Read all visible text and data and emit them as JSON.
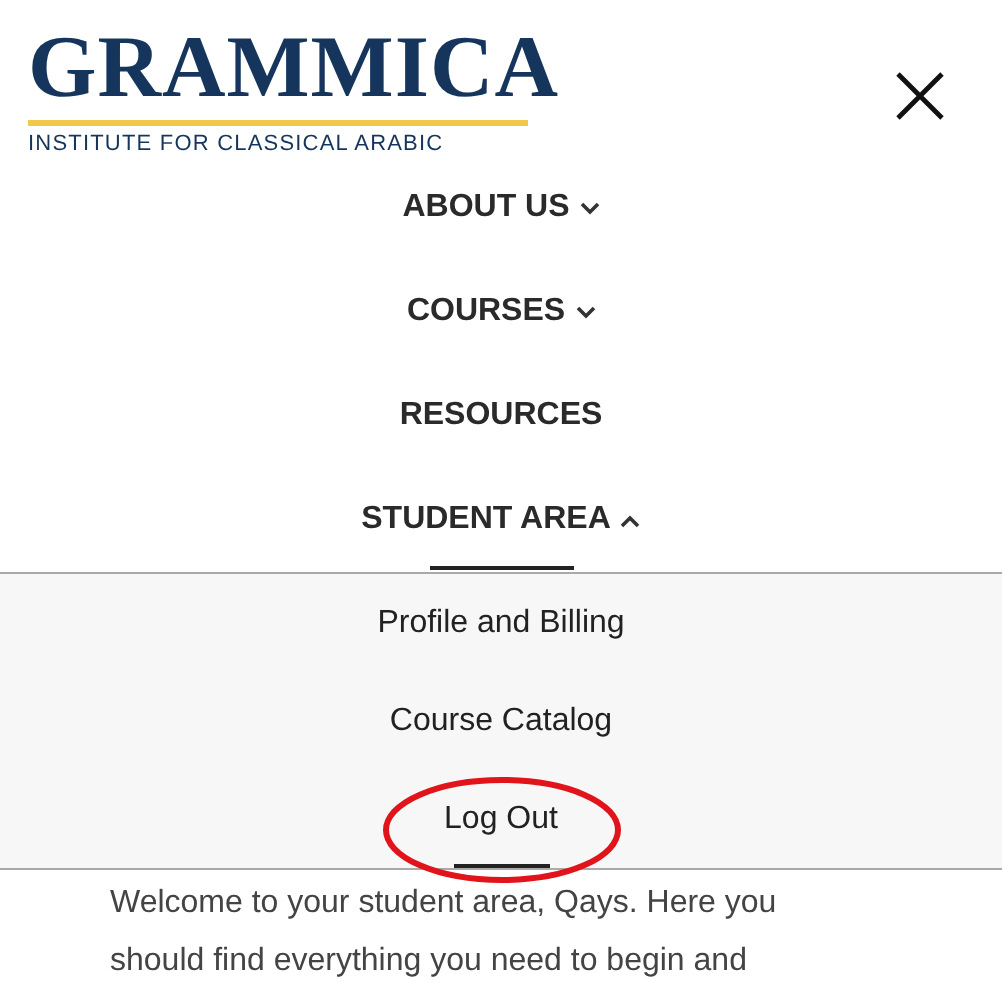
{
  "logo": {
    "title": "GRAMMICA",
    "subtitle": "INSTITUTE FOR CLASSICAL ARABIC"
  },
  "nav": [
    {
      "label": "ABOUT US",
      "kind": "closed",
      "selected": false
    },
    {
      "label": "COURSES",
      "kind": "closed",
      "selected": false
    },
    {
      "label": "RESOURCES",
      "kind": "link",
      "selected": false
    },
    {
      "label": "STUDENT AREA",
      "kind": "open",
      "selected": true
    }
  ],
  "submenu": [
    {
      "label": "Profile and Billing",
      "selected": false
    },
    {
      "label": "Course Catalog",
      "selected": false
    },
    {
      "label": "Log Out",
      "selected": true,
      "circled": true
    }
  ],
  "body": "Welcome to your student area, Qays. Here you should find everything you need to begin and"
}
